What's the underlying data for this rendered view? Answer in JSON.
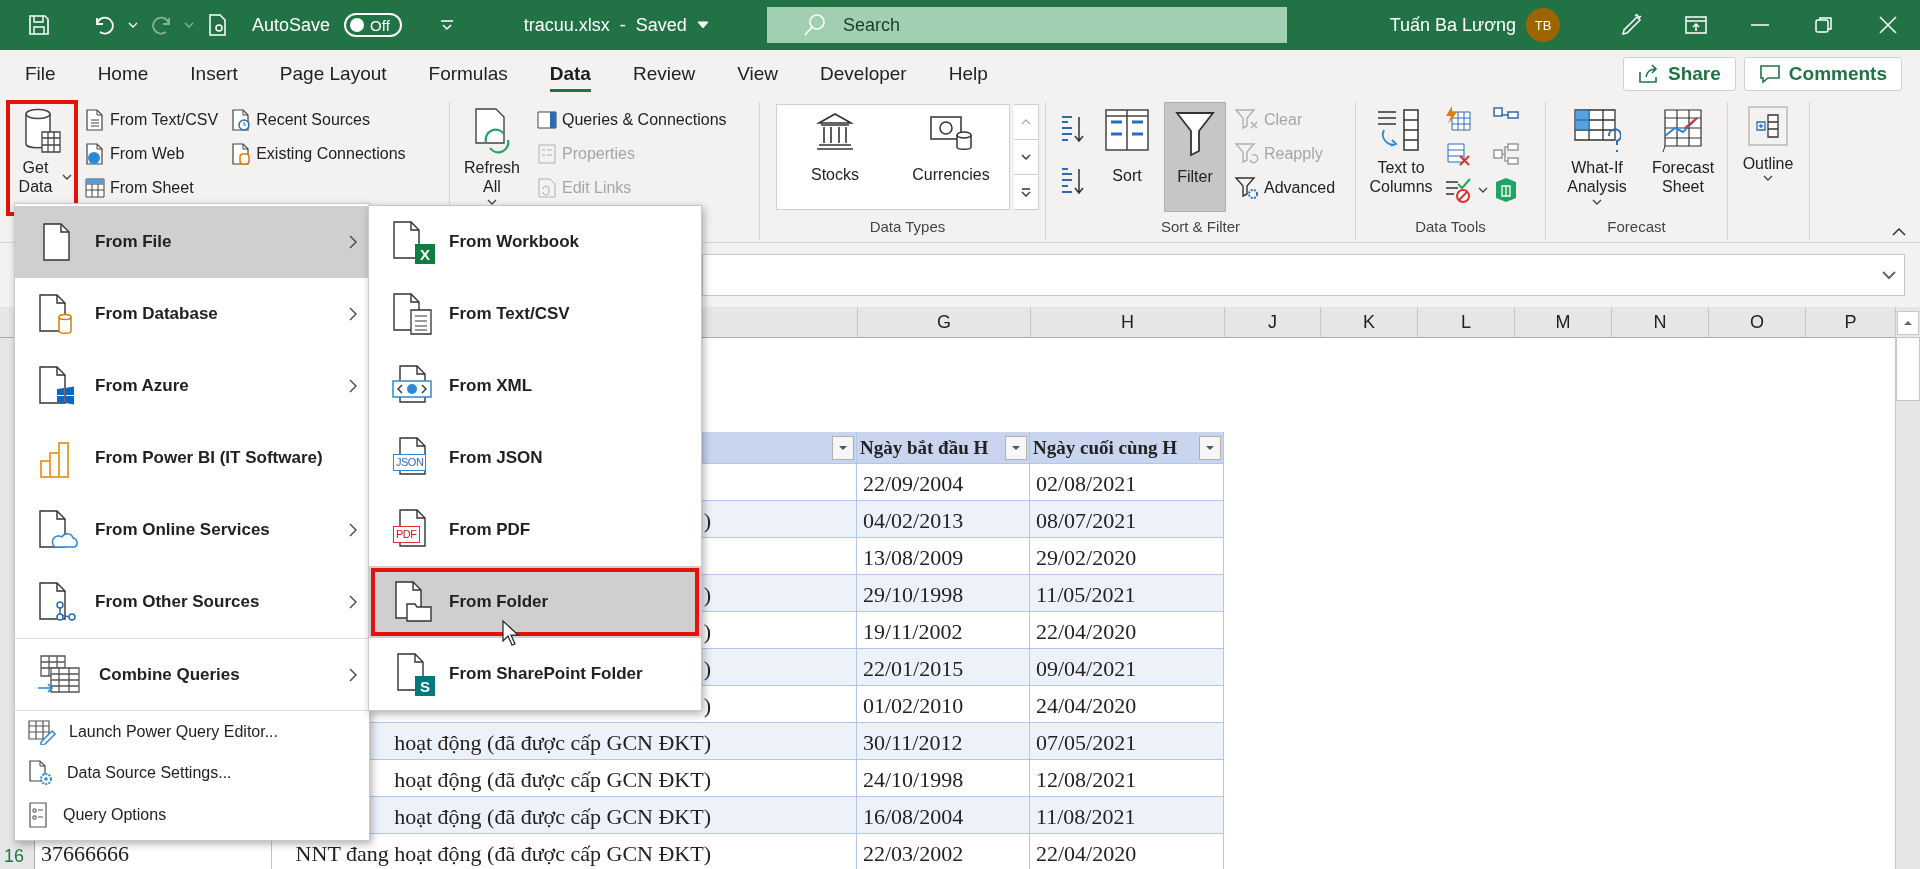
{
  "title_bar": {
    "autosave_label": "AutoSave",
    "autosave_toggle": {
      "label": "Off",
      "on": false
    },
    "file_title": "tracuu.xlsx  -  Saved",
    "search": {
      "placeholder": "Search"
    },
    "user_name": "Tuấn Ba Lương",
    "avatar_initials": "TB"
  },
  "ribbon_tabs": [
    {
      "label": "File",
      "selected": false
    },
    {
      "label": "Home",
      "selected": false
    },
    {
      "label": "Insert",
      "selected": false
    },
    {
      "label": "Page Layout",
      "selected": false
    },
    {
      "label": "Formulas",
      "selected": false
    },
    {
      "label": "Data",
      "selected": true
    },
    {
      "label": "Review",
      "selected": false
    },
    {
      "label": "View",
      "selected": false
    },
    {
      "label": "Developer",
      "selected": false
    },
    {
      "label": "Help",
      "selected": false
    }
  ],
  "share_button": "Share",
  "comments_button": "Comments",
  "ribbon": {
    "get_data": {
      "label": "Get Data",
      "annotated": true
    },
    "get_transform": [
      {
        "label": "From Text/CSV"
      },
      {
        "label": "From Web"
      },
      {
        "label": "From Sheet"
      },
      {
        "label": "Recent Sources"
      },
      {
        "label": "Existing Connections"
      }
    ],
    "refresh_all": "Refresh All",
    "queries": [
      {
        "label": "Queries & Connections",
        "disabled": false
      },
      {
        "label": "Properties",
        "disabled": true
      },
      {
        "label": "Edit Links",
        "disabled": true
      }
    ],
    "data_types": {
      "label": "Data Types",
      "items": [
        "Stocks",
        "Currencies"
      ]
    },
    "sort_filter": {
      "label": "Sort & Filter",
      "sort": "Sort",
      "filter": {
        "label": "Filter",
        "on": true
      },
      "commands": [
        {
          "label": "Clear",
          "disabled": true
        },
        {
          "label": "Reapply",
          "disabled": true
        },
        {
          "label": "Advanced",
          "disabled": false
        }
      ]
    },
    "data_tools": {
      "label": "Data Tools",
      "text_to_columns": "Text to Columns"
    },
    "forecast": {
      "label": "Forecast",
      "what_if": "What-If Analysis",
      "forecast_sheet": "Forecast Sheet"
    },
    "outline": "Outline"
  },
  "get_data_menu": [
    {
      "label": "From File",
      "kind": "submenu",
      "selected": true,
      "divider_above": false
    },
    {
      "label": "From Database",
      "kind": "submenu",
      "selected": false,
      "divider_above": false
    },
    {
      "label": "From Azure",
      "kind": "submenu",
      "selected": false,
      "divider_above": false
    },
    {
      "label": "From Power BI (IT Software)",
      "kind": "source",
      "selected": false,
      "divider_above": false
    },
    {
      "label": "From Online Services",
      "kind": "submenu",
      "selected": false,
      "divider_above": false
    },
    {
      "label": "From Other Sources",
      "kind": "submenu",
      "selected": false,
      "divider_above": false
    },
    {
      "label": "Combine Queries",
      "kind": "submenu",
      "selected": false,
      "divider_above": true
    },
    {
      "label": "Launch Power Query Editor...",
      "kind": "command",
      "selected": false,
      "divider_above": true
    },
    {
      "label": "Data Source Settings...",
      "kind": "command",
      "selected": false,
      "divider_above": false
    },
    {
      "label": "Query Options",
      "kind": "command",
      "selected": false,
      "divider_above": false
    }
  ],
  "from_file_menu": [
    {
      "label": "From Workbook",
      "badge": "X",
      "selected": false,
      "annotated": false
    },
    {
      "label": "From Text/CSV",
      "selected": false,
      "annotated": false
    },
    {
      "label": "From XML",
      "selected": false,
      "annotated": false
    },
    {
      "label": "From JSON",
      "badge": "JSON",
      "selected": false,
      "annotated": false
    },
    {
      "label": "From PDF",
      "badge": "PDF",
      "selected": false,
      "annotated": false
    },
    {
      "label": "From Folder",
      "selected": true,
      "annotated": true
    },
    {
      "label": "From SharePoint Folder",
      "badge": "S",
      "selected": false,
      "annotated": false
    }
  ],
  "sheet": {
    "column_headers": [
      "G",
      "H",
      "J",
      "K",
      "L",
      "M",
      "N",
      "O",
      "P"
    ],
    "table_headers": [
      "Ngày bắt đầu H",
      "Ngày cuối cùng H"
    ],
    "rows": [
      {
        "g": "22/09/2004",
        "h": "02/08/2021"
      },
      {
        "f": ")",
        "g": "04/02/2013",
        "h": "08/07/2021"
      },
      {
        "g": "13/08/2009",
        "h": "29/02/2020"
      },
      {
        "f": ")",
        "g": "29/10/1998",
        "h": "11/05/2021"
      },
      {
        "f": ")",
        "g": "19/11/2002",
        "h": "22/04/2020"
      },
      {
        "f": ")",
        "g": "22/01/2015",
        "h": "09/04/2021"
      },
      {
        "f": ")",
        "g": "01/02/2010",
        "h": "24/04/2020"
      },
      {
        "f": "hoạt động (đã được cấp GCN ĐKT)",
        "g": "30/11/2012",
        "h": "07/05/2021"
      },
      {
        "f": "hoạt động (đã được cấp GCN ĐKT)",
        "g": "24/10/1998",
        "h": "12/08/2021"
      },
      {
        "f": "hoạt động (đã được cấp GCN ĐKT)",
        "g": "16/08/2004",
        "h": "11/08/2021"
      },
      {
        "row_number": "16",
        "a": "37666666",
        "f": "NNT đang hoạt động (đã được cấp GCN ĐKT)",
        "g": "22/03/2002",
        "h": "22/04/2020"
      }
    ]
  }
}
